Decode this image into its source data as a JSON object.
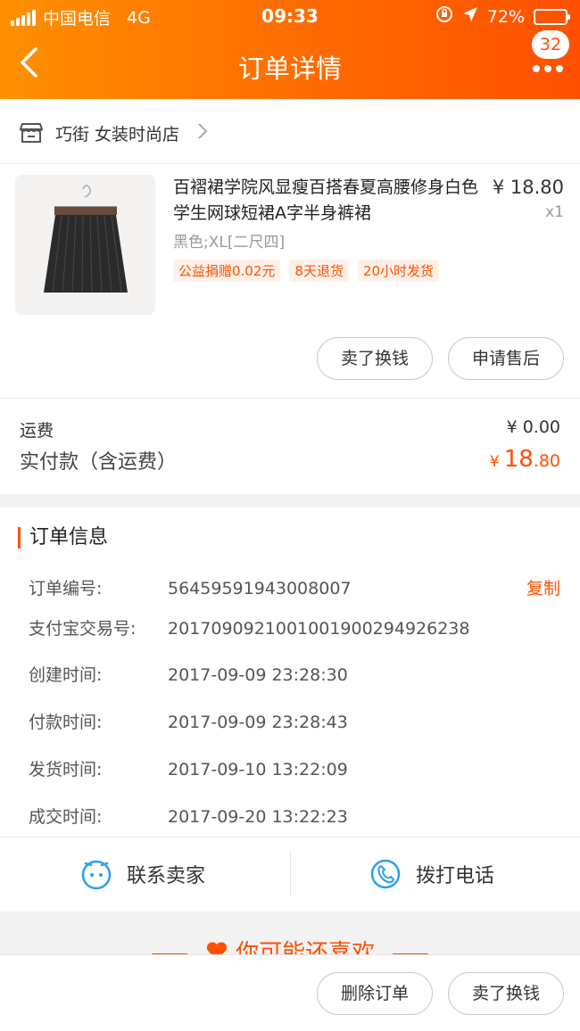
{
  "status_bar": {
    "carrier": "中国电信",
    "network": "4G",
    "time": "09:33",
    "battery": "72%"
  },
  "nav": {
    "title": "订单详情",
    "back_icon": "chevron-left-icon",
    "more_icon": "more-dots-icon",
    "badge_count": "32"
  },
  "shop": {
    "name": "巧街 女装时尚店",
    "icon": "shop-icon"
  },
  "product": {
    "title": "百褶裙学院风显瘦百搭春夏高腰修身白色学生网球短裙A字半身裤裙",
    "price": "¥ 18.80",
    "qty": "x1",
    "sku": "黑色;XL[二尺四]",
    "tags": [
      "公益捐赠0.02元",
      "8天退货",
      "20小时发货"
    ]
  },
  "actions": {
    "sell": "卖了换钱",
    "after_sale": "申请售后"
  },
  "summary": {
    "shipping_label": "运费",
    "shipping_value": "¥ 0.00",
    "paid_label": "实付款（含运费）",
    "paid_currency": "¥",
    "paid_int": "18",
    "paid_dec": ".80"
  },
  "order_info": {
    "title": "订单信息",
    "copy_label": "复制",
    "rows": [
      {
        "label": "订单编号:",
        "value": "56459591943008007"
      },
      {
        "label": "支付宝交易号:",
        "value": "2017090921001001900294926238"
      },
      {
        "label": "创建时间:",
        "value": "2017-09-09 23:28:30"
      },
      {
        "label": "付款时间:",
        "value": "2017-09-09 23:28:43"
      },
      {
        "label": "发货时间:",
        "value": "2017-09-10 13:22:09"
      },
      {
        "label": "成交时间:",
        "value": "2017-09-20 13:22:23"
      }
    ]
  },
  "contact": {
    "seller": "联系卖家",
    "phone": "拨打电话"
  },
  "recommend": {
    "title": "你可能还喜欢"
  },
  "bottom": {
    "delete": "删除订单",
    "sell": "卖了换钱"
  },
  "colors": {
    "accent": "#ff5000",
    "header_start": "#ff9000",
    "link_blue": "#2a9ff0"
  }
}
